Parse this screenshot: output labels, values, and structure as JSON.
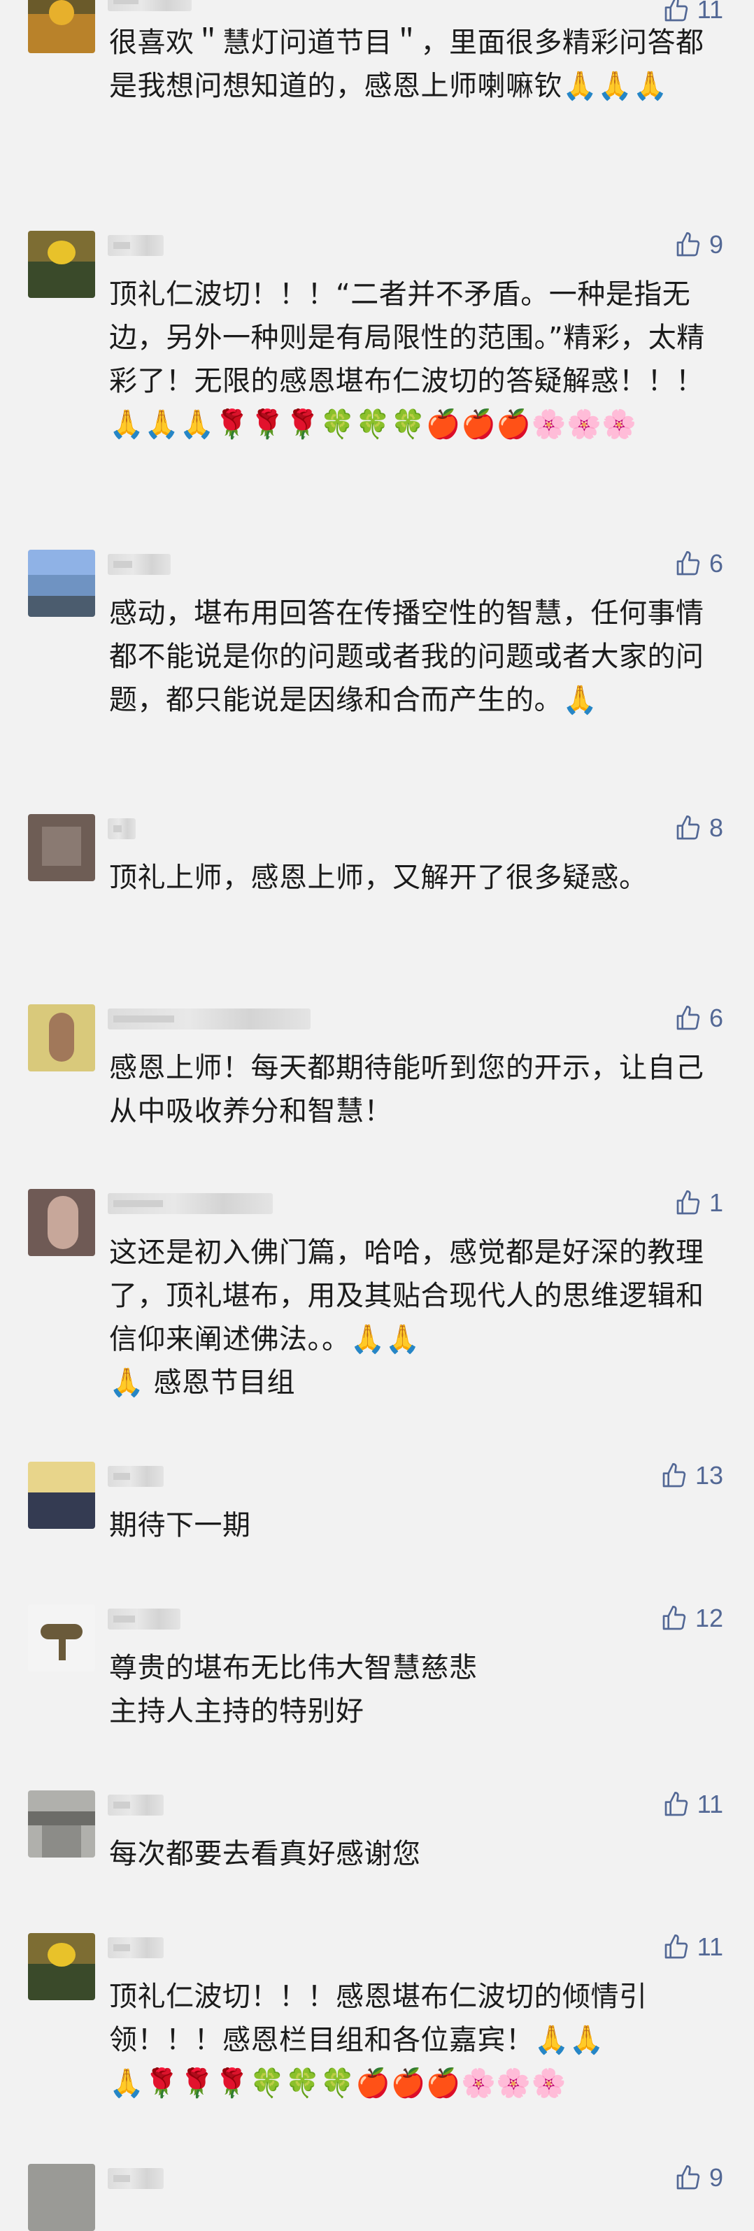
{
  "comments": [
    {
      "likes": "11",
      "text": "很喜欢＂慧灯问道节目＂，里面很多精彩问答都是我想问想知道的，感恩上师喇嘛钦🙏🙏🙏",
      "avatar": "avatar-sunset"
    },
    {
      "likes": "9",
      "text": "顶礼仁波切！！！“二者并不矛盾。一种是指无边，另外一种则是有局限性的范围。”精彩，太精彩了！无限的感恩堪布仁波切的答疑解惑！！！ 🙏🙏🙏🌹🌹🌹🍀🍀🍀🍎🍎🍎🌸🌸🌸",
      "avatar": "avatar-sunset"
    },
    {
      "likes": "6",
      "text": "感动，堪布用回答在传播空性的智慧，任何事情都不能说是你的问题或者我的问题或者大家的问题，都只能说是因缘和合而产生的。🙏",
      "avatar": "avatar-sky"
    },
    {
      "likes": "8",
      "text": "顶礼上师，感恩上师，又解开了很多疑惑。",
      "avatar": "avatar-brown"
    },
    {
      "likes": "6",
      "text": "感恩上师！每天都期待能听到您的开示，让自己从中吸收养分和智慧！",
      "avatar": "avatar-statue"
    },
    {
      "likes": "1",
      "text": "这还是初入佛门篇，哈哈，感觉都是好深的教理了，顶礼堪布，用及其贴合现代人的思维逻辑和信仰来阐述佛法。。🙏🙏\n🙏 感恩节目组",
      "avatar": "avatar-person"
    },
    {
      "likes": "13",
      "text": "期待下一期",
      "avatar": "avatar-dusk"
    },
    {
      "likes": "12",
      "text": "尊贵的堪布无比伟大智慧慈悲\n主持人主持的特别好",
      "avatar": "avatar-bird"
    },
    {
      "likes": "11",
      "text": "每次都要去看真好感谢您",
      "avatar": "avatar-gray"
    },
    {
      "likes": "11",
      "text": "顶礼仁波切！！！感恩堪布仁波切的倾情引领！！！感恩栏目组和各位嘉宾！🙏🙏\n🙏🌹🌹🌹🍀🍀🍀🍎🍎🍎🌸🌸🌸",
      "avatar": "avatar-sunset"
    },
    {
      "likes": "9",
      "text": "",
      "avatar": "avatar-gray"
    }
  ],
  "icons": {
    "like": "thumbs-up-icon"
  },
  "colors": {
    "accent": "#536895",
    "background": "#f2f2f2"
  }
}
